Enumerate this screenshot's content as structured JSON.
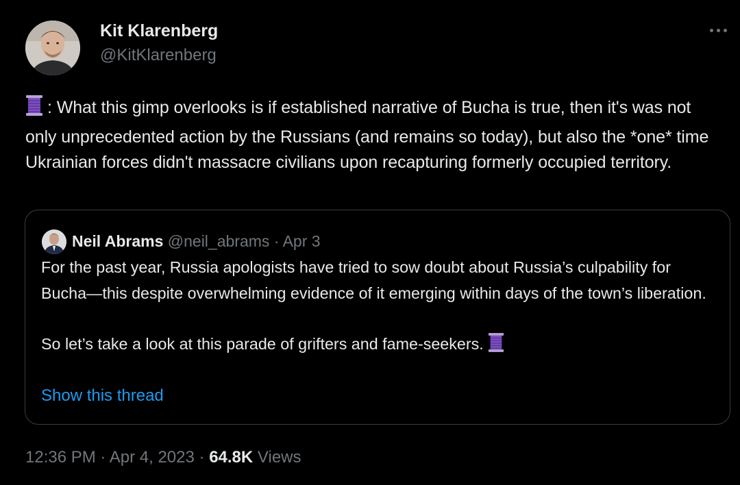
{
  "tweet": {
    "author": {
      "display_name": "Kit Klarenberg",
      "handle": "@KitKlarenberg"
    },
    "thread_marker": "🧵",
    "text": ": What this gimp overlooks is if established narrative of Bucha is true, then it's was not only unprecedented action by the Russians (and remains so today), but also the *one* time Ukrainian forces didn't massacre civilians upon recapturing formerly occupied territory.",
    "quoted": {
      "display_name": "Neil Abrams",
      "handle": "@neil_abrams",
      "separator": "·",
      "date": "Apr 3",
      "paragraph_1": "For the past year, Russia apologists have tried to sow doubt about Russia’s culpability for Bucha—this despite overwhelming evidence of it emerging within days of the town’s liberation.",
      "paragraph_2": "So let’s take a look at this parade of grifters and fame-seekers.",
      "thread_marker": "🧵",
      "show_thread_label": "Show this thread"
    },
    "meta": {
      "time": "12:36 PM",
      "separator": "·",
      "date": "Apr 4, 2023",
      "views_count": "64.8K",
      "views_label": "Views"
    },
    "colors": {
      "background": "#000000",
      "text": "#e7e9ea",
      "muted": "#71767b",
      "link": "#1d9bf0",
      "border": "#3a3d41"
    },
    "icons": {
      "more": "more-dots-icon",
      "thread": "thread-spool-icon"
    }
  }
}
